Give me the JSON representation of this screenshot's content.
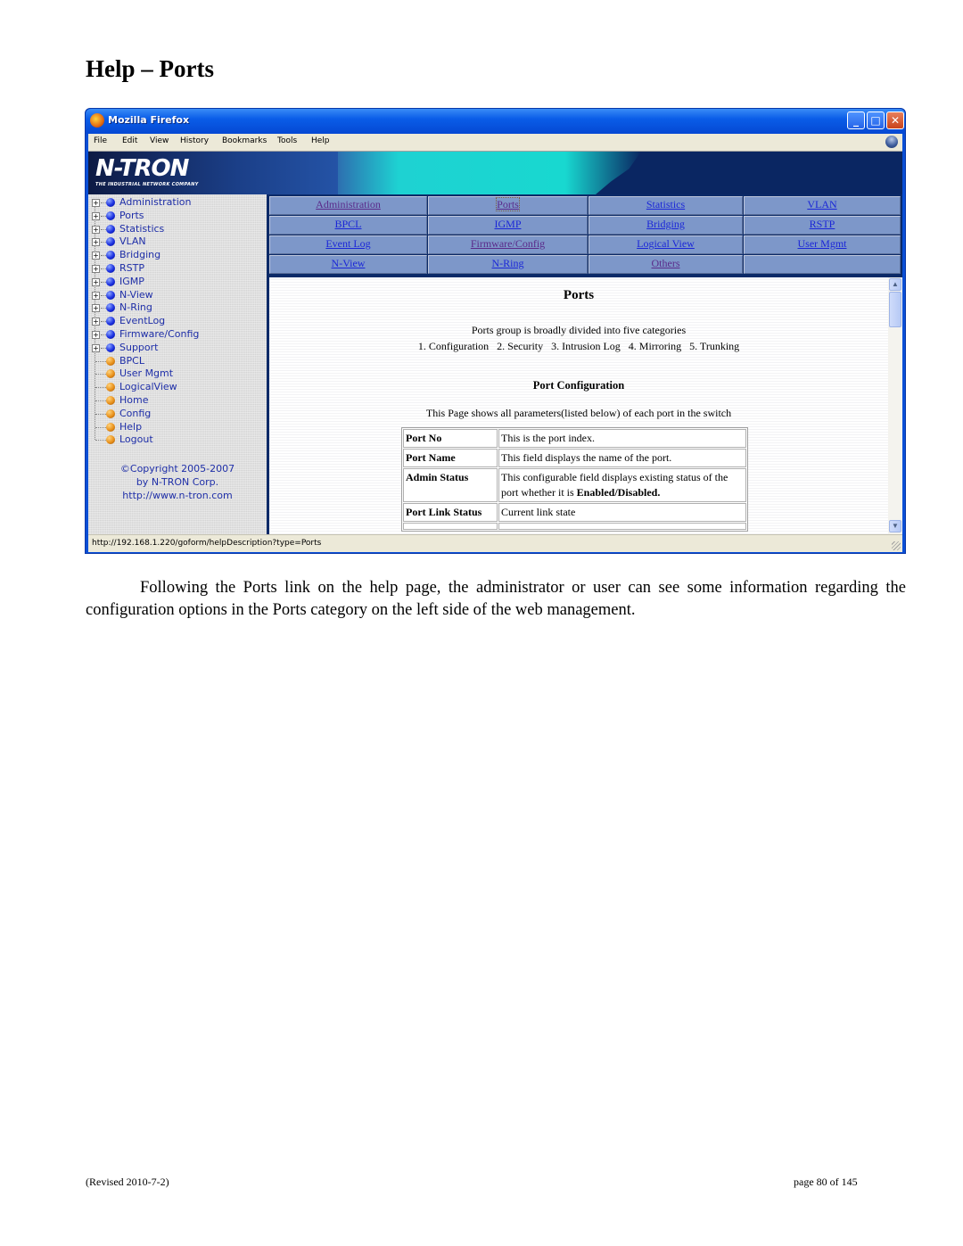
{
  "document": {
    "title": "Help – Ports",
    "body_paragraph": "Following the Ports link on the help page, the administrator or user can see some information regarding the configuration options in the Ports category on the left side of the web management.",
    "footer_revised": "(Revised 2010-7-2)",
    "footer_page": "page 80 of 145"
  },
  "browser": {
    "window_title": "Mozilla Firefox",
    "window_buttons": {
      "minimize": "_",
      "maximize": "□",
      "close": "✕"
    },
    "menu": [
      "File",
      "Edit",
      "View",
      "History",
      "Bookmarks",
      "Tools",
      "Help"
    ],
    "status_url": "http://192.168.1.220/goform/helpDescription?type=Ports"
  },
  "banner": {
    "logo": "N-TRON",
    "tagline": "THE INDUSTRIAL NETWORK COMPANY"
  },
  "sidebar": {
    "items": [
      {
        "label": "Administration",
        "expandable": true,
        "bullet": "blue"
      },
      {
        "label": "Ports",
        "expandable": true,
        "bullet": "blue"
      },
      {
        "label": "Statistics",
        "expandable": true,
        "bullet": "blue"
      },
      {
        "label": "VLAN",
        "expandable": true,
        "bullet": "blue"
      },
      {
        "label": "Bridging",
        "expandable": true,
        "bullet": "blue"
      },
      {
        "label": "RSTP",
        "expandable": true,
        "bullet": "blue"
      },
      {
        "label": "IGMP",
        "expandable": true,
        "bullet": "blue"
      },
      {
        "label": "N-View",
        "expandable": true,
        "bullet": "blue"
      },
      {
        "label": "N-Ring",
        "expandable": true,
        "bullet": "blue"
      },
      {
        "label": "EventLog",
        "expandable": true,
        "bullet": "blue"
      },
      {
        "label": "Firmware/Config",
        "expandable": true,
        "bullet": "blue"
      },
      {
        "label": "Support",
        "expandable": true,
        "bullet": "blue"
      },
      {
        "label": "BPCL",
        "expandable": false,
        "bullet": "orange"
      },
      {
        "label": "User Mgmt",
        "expandable": false,
        "bullet": "orange"
      },
      {
        "label": "LogicalView",
        "expandable": false,
        "bullet": "orange"
      },
      {
        "label": "Home",
        "expandable": false,
        "bullet": "orange"
      },
      {
        "label": "Config",
        "expandable": false,
        "bullet": "orange"
      },
      {
        "label": "Help",
        "expandable": false,
        "bullet": "orange"
      },
      {
        "label": "Logout",
        "expandable": false,
        "bullet": "orange"
      }
    ],
    "expander_glyph": "+",
    "copyright": [
      "©Copyright 2005-2007",
      "by N-TRON Corp.",
      "http://www.n-tron.com"
    ]
  },
  "nav_links": [
    [
      {
        "label": "Administration",
        "state": "visited"
      },
      {
        "label": "Ports",
        "state": "focused"
      },
      {
        "label": "Statistics",
        "state": "link"
      },
      {
        "label": "VLAN",
        "state": "link"
      }
    ],
    [
      {
        "label": "BPCL",
        "state": "link"
      },
      {
        "label": "IGMP",
        "state": "link"
      },
      {
        "label": "Bridging",
        "state": "link"
      },
      {
        "label": "RSTP",
        "state": "link"
      }
    ],
    [
      {
        "label": "Event Log",
        "state": "link"
      },
      {
        "label": "Firmware/Config",
        "state": "visited"
      },
      {
        "label": "Logical View",
        "state": "link"
      },
      {
        "label": "User Mgmt",
        "state": "link"
      }
    ],
    [
      {
        "label": "N-View",
        "state": "link"
      },
      {
        "label": "N-Ring",
        "state": "link"
      },
      {
        "label": "Others",
        "state": "visited"
      },
      {
        "label": "",
        "state": "empty"
      }
    ]
  ],
  "help": {
    "title": "Ports",
    "intro": "Ports group is broadly divided into five categories",
    "categories": "1. Configuration   2. Security   3. Intrusion Log   4. Mirroring   5. Trunking",
    "section_title": "Port Configuration",
    "section_intro": "This Page shows all parameters(listed below) of each port in the switch",
    "params": [
      {
        "name": "Port No",
        "description": "This is the port index."
      },
      {
        "name": "Port Name",
        "description": "This field displays the name of the port."
      },
      {
        "name": "Admin Status",
        "description": "This configurable field displays existing status of the port whether it is ",
        "description_bold": "Enabled/Disabled."
      },
      {
        "name": "Port Link Status",
        "description": "Current link state"
      },
      {
        "name": "",
        "description": ""
      }
    ]
  },
  "scrollbar": {
    "up": "▲",
    "down": "▼",
    "position": 0.0
  }
}
